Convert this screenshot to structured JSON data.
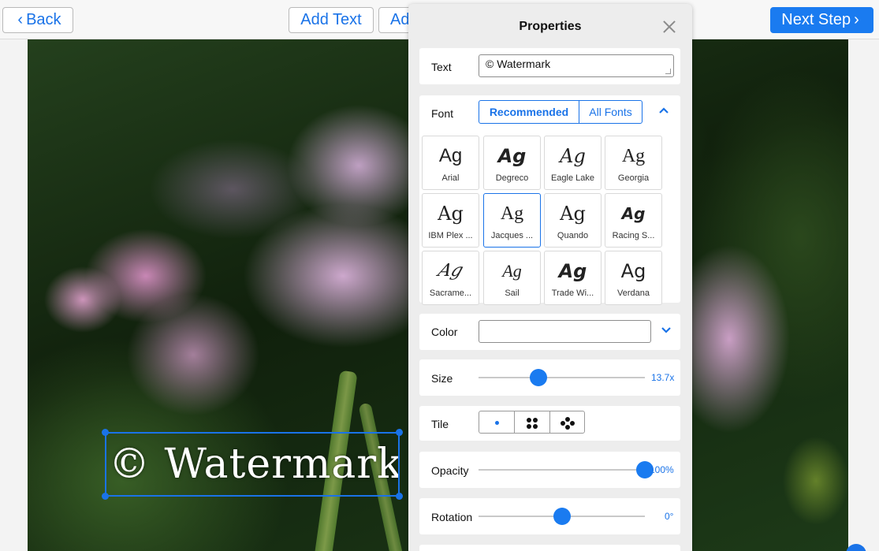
{
  "toolbar": {
    "back_label": "Back",
    "add_text_label": "Add Text",
    "add_second_label": "Ad",
    "next_step_label": "Next Step"
  },
  "canvas": {
    "watermark_text": "© Watermark"
  },
  "properties": {
    "title": "Properties",
    "text": {
      "label": "Text",
      "value": "© Watermark"
    },
    "font": {
      "label": "Font",
      "tabs": [
        "Recommended",
        "All Fonts"
      ],
      "active_tab": "Recommended",
      "sample": "Ag",
      "fonts": [
        {
          "name": "Arial"
        },
        {
          "name": "Degreco"
        },
        {
          "name": "Eagle Lake"
        },
        {
          "name": "Georgia"
        },
        {
          "name": "IBM Plex ..."
        },
        {
          "name": "Jacques ..."
        },
        {
          "name": "Quando"
        },
        {
          "name": "Racing S..."
        },
        {
          "name": "Sacrame..."
        },
        {
          "name": "Sail"
        },
        {
          "name": "Trade Wi..."
        },
        {
          "name": "Verdana"
        }
      ],
      "selected": "Jacques ..."
    },
    "color": {
      "label": "Color",
      "value": "#ffffff"
    },
    "size": {
      "label": "Size",
      "value_text": "13.7x",
      "slider_fraction": 0.36
    },
    "tile": {
      "label": "Tile",
      "options": [
        "single-dot-icon",
        "four-dots-icon",
        "five-dots-icon"
      ],
      "selected": "single-dot-icon"
    },
    "opacity": {
      "label": "Opacity",
      "value_text": "100%",
      "slider_fraction": 1.0
    },
    "rotation": {
      "label": "Rotation",
      "value_text": "0°",
      "slider_fraction": 0.5
    }
  },
  "colors": {
    "accent": "#1a73e8",
    "primary_button": "#1a7bf0",
    "panel_bg": "#ededed"
  }
}
